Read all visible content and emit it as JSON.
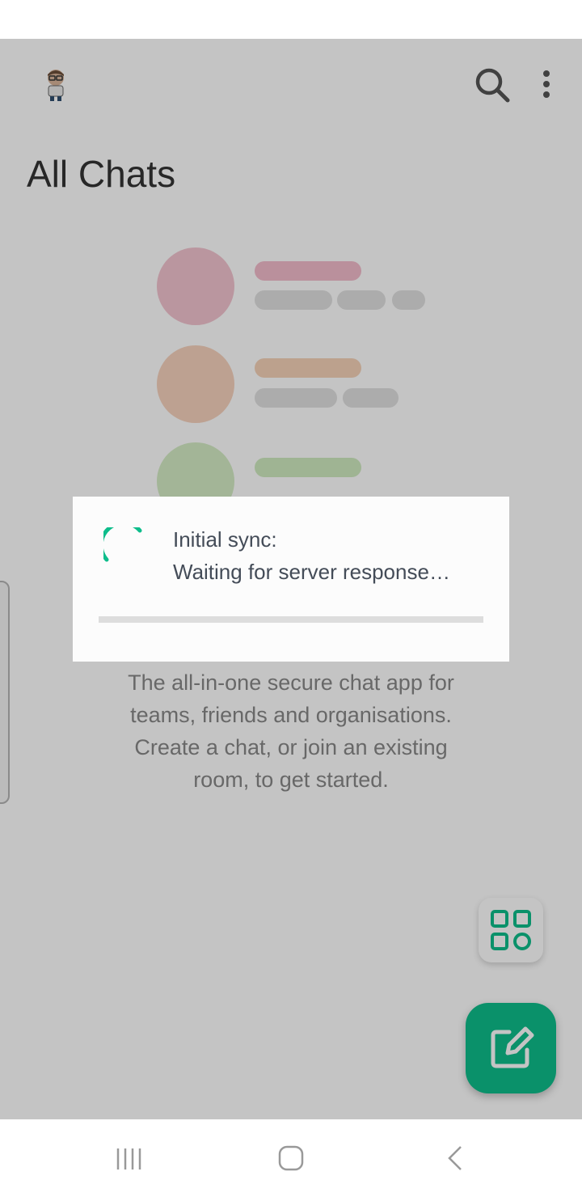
{
  "header": {
    "title": "All Chats",
    "avatar_icon": "user-avatar-icon",
    "search_icon": "search-icon",
    "menu_icon": "more-vert-icon"
  },
  "empty_state": {
    "description": "The all-in-one secure chat app for teams, friends and organisations. Create a chat, or join an existing room, to get started."
  },
  "dialog": {
    "title": "Initial sync:",
    "message": "Waiting for server response…",
    "progress": 0
  },
  "fabs": {
    "spaces_icon": "spaces-grid-icon",
    "compose_icon": "compose-icon"
  },
  "nav_bar": {
    "recents_icon": "recents-icon",
    "home_icon": "home-icon",
    "back_icon": "back-icon"
  },
  "colors": {
    "accent": "#0dbd8b",
    "scrim": "rgba(0,0,0,0.23)",
    "title_text": "#333333",
    "dialog_text": "#444c58"
  }
}
